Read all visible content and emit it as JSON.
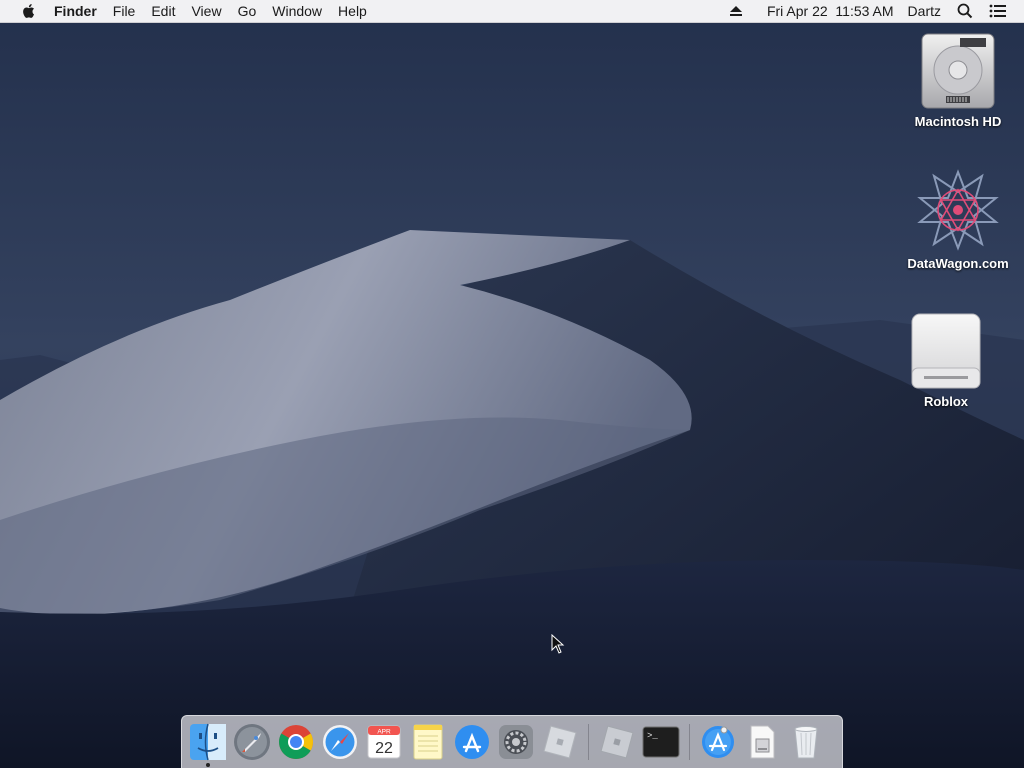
{
  "menubar": {
    "apple_icon": "apple-logo-icon",
    "app_name": "Finder",
    "menus": [
      "File",
      "Edit",
      "View",
      "Go",
      "Window",
      "Help"
    ],
    "status": {
      "eject_icon": "eject-icon",
      "datetime": "Fri Apr 22  11:53 AM",
      "user": "Dartz",
      "search_icon": "spotlight-search-icon",
      "notification_icon": "notification-center-icon"
    }
  },
  "desktop": {
    "icons": [
      {
        "label": "Macintosh HD",
        "icon": "hard-drive-icon"
      },
      {
        "label": "DataWagon.com",
        "icon": "datawagon-star-icon"
      },
      {
        "label": "Roblox",
        "icon": "external-disk-icon"
      }
    ]
  },
  "dock": {
    "items": [
      {
        "name": "Finder",
        "icon": "finder-icon",
        "running": true
      },
      {
        "name": "Launchpad",
        "icon": "launchpad-rocket-icon"
      },
      {
        "name": "Google Chrome",
        "icon": "chrome-icon"
      },
      {
        "name": "Safari",
        "icon": "safari-compass-icon"
      },
      {
        "name": "Calendar",
        "icon": "calendar-icon",
        "month": "APR",
        "day": "22"
      },
      {
        "name": "Notes",
        "icon": "notes-icon"
      },
      {
        "name": "App Store",
        "icon": "app-store-icon"
      },
      {
        "name": "System Preferences",
        "icon": "system-preferences-gear-icon"
      },
      {
        "name": "Roblox",
        "icon": "roblox-icon"
      },
      {
        "name": "Roblox Studio",
        "icon": "roblox-studio-icon"
      },
      {
        "name": "Terminal",
        "icon": "terminal-icon",
        "prompt": ">_"
      },
      {
        "name": "Downloads",
        "icon": "downloads-stack-icon"
      },
      {
        "name": "Documents",
        "icon": "documents-stack-icon"
      },
      {
        "name": "Trash",
        "icon": "trash-icon"
      }
    ]
  },
  "colors": {
    "menubar_bg": "#f1f1f3",
    "sky_top": "#22304d",
    "dune_light": "#8a93a8",
    "label_text": "#ffffff"
  }
}
